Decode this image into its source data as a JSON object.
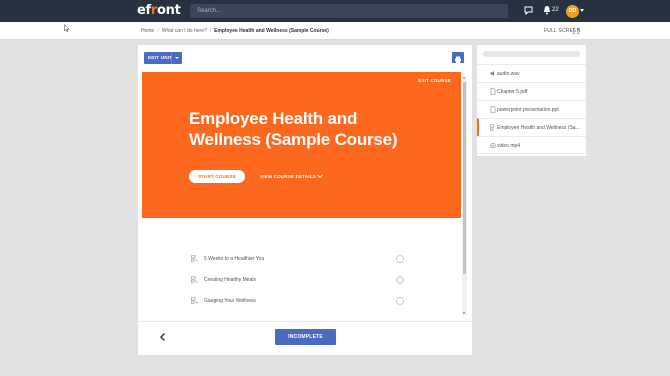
{
  "header": {
    "logo_pre": "ef",
    "logo_o": "r",
    "logo_post": "ont",
    "search_placeholder": "Search...",
    "notification_count": "22",
    "avatar_initials": "DD",
    "icons": [
      "chat-icon",
      "bell-icon",
      "chevron-down-icon"
    ]
  },
  "breadcrumb": {
    "items": [
      "Home",
      "What can I do here?",
      "Employee Health and Wellness (Sample Course)"
    ],
    "separator": "/"
  },
  "fullscreen_label": "FULL SCREEN",
  "toolbar": {
    "edit_unit_label": "EDIT UNIT",
    "print_icon": "print-icon"
  },
  "course": {
    "exit_label": "EXIT COURSE",
    "title": "Employee Health and Wellness (Sample Course)",
    "start_label": "START COURSE",
    "details_label": "VIEW COURSE DETAILS",
    "units": [
      {
        "label": "5 Weeks to a Healthier You"
      },
      {
        "label": "Creating Healthy Meals"
      },
      {
        "label": "Gauging Your Wellness"
      }
    ]
  },
  "footer": {
    "incomplete_label": "INCOMPLETE"
  },
  "side_panel": {
    "items": [
      {
        "label": "audio.wav",
        "icon": "audio-icon",
        "active": false
      },
      {
        "label": "Chapter 5.pdf",
        "icon": "file-icon",
        "active": false
      },
      {
        "label": "powerpoint presentation.ppt",
        "icon": "file-icon",
        "active": false
      },
      {
        "label": "Employee Health and Wellness (Sa...",
        "icon": "course-icon",
        "active": true
      },
      {
        "label": "video.mp4",
        "icon": "video-icon",
        "active": false
      }
    ]
  },
  "colors": {
    "topbar": "#273240",
    "accent_orange": "#fd681f",
    "button_blue": "#4a6cc0",
    "background": "#e2e2e2"
  }
}
